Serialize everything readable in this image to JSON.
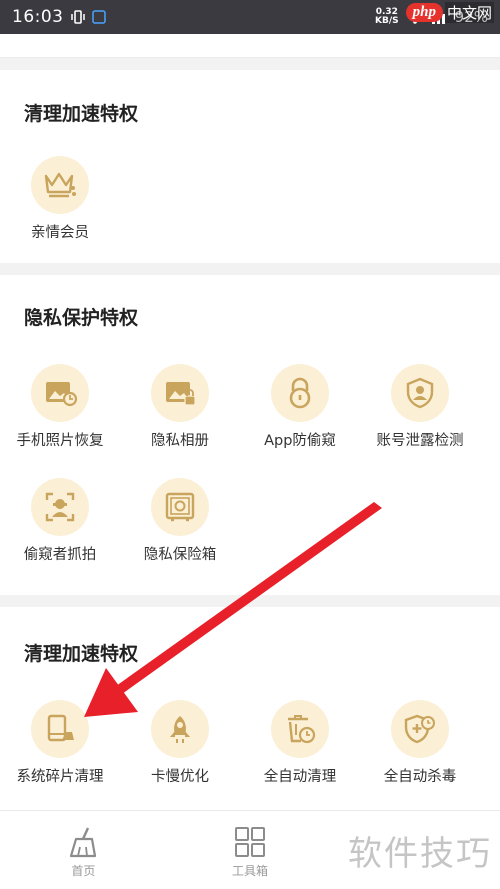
{
  "status": {
    "time": "16:03",
    "speed_value": "0.32",
    "speed_unit": "KB/S",
    "battery": "92%"
  },
  "watermark_top": {
    "brand": "php",
    "site": "中文网"
  },
  "sections": [
    {
      "title": "清理加速特权",
      "items": [
        {
          "label": "亲情会员",
          "icon": "crown-icon"
        }
      ]
    },
    {
      "title": "隐私保护特权",
      "items": [
        {
          "label": "手机照片恢复",
          "icon": "photo-restore-icon"
        },
        {
          "label": "隐私相册",
          "icon": "private-album-icon"
        },
        {
          "label": "App防偷窥",
          "icon": "lock-icon"
        },
        {
          "label": "账号泄露检测",
          "icon": "shield-user-icon"
        },
        {
          "label": "偷窥者抓拍",
          "icon": "spy-capture-icon"
        },
        {
          "label": "隐私保险箱",
          "icon": "safe-icon"
        }
      ]
    },
    {
      "title": "清理加速特权",
      "items": [
        {
          "label": "系统碎片清理",
          "icon": "fragment-clean-icon"
        },
        {
          "label": "卡慢优化",
          "icon": "rocket-icon"
        },
        {
          "label": "全自动清理",
          "icon": "auto-clean-icon"
        },
        {
          "label": "全自动杀毒",
          "icon": "auto-antivirus-icon"
        }
      ]
    }
  ],
  "tabbar": {
    "home_label": "首页",
    "toolbox_label": "工具箱"
  },
  "watermark_bottom": "软件技巧",
  "colors": {
    "icon_bg": "#fbf0d6",
    "icon_fg": "#c9a45c",
    "arrow": "#e8202a"
  }
}
